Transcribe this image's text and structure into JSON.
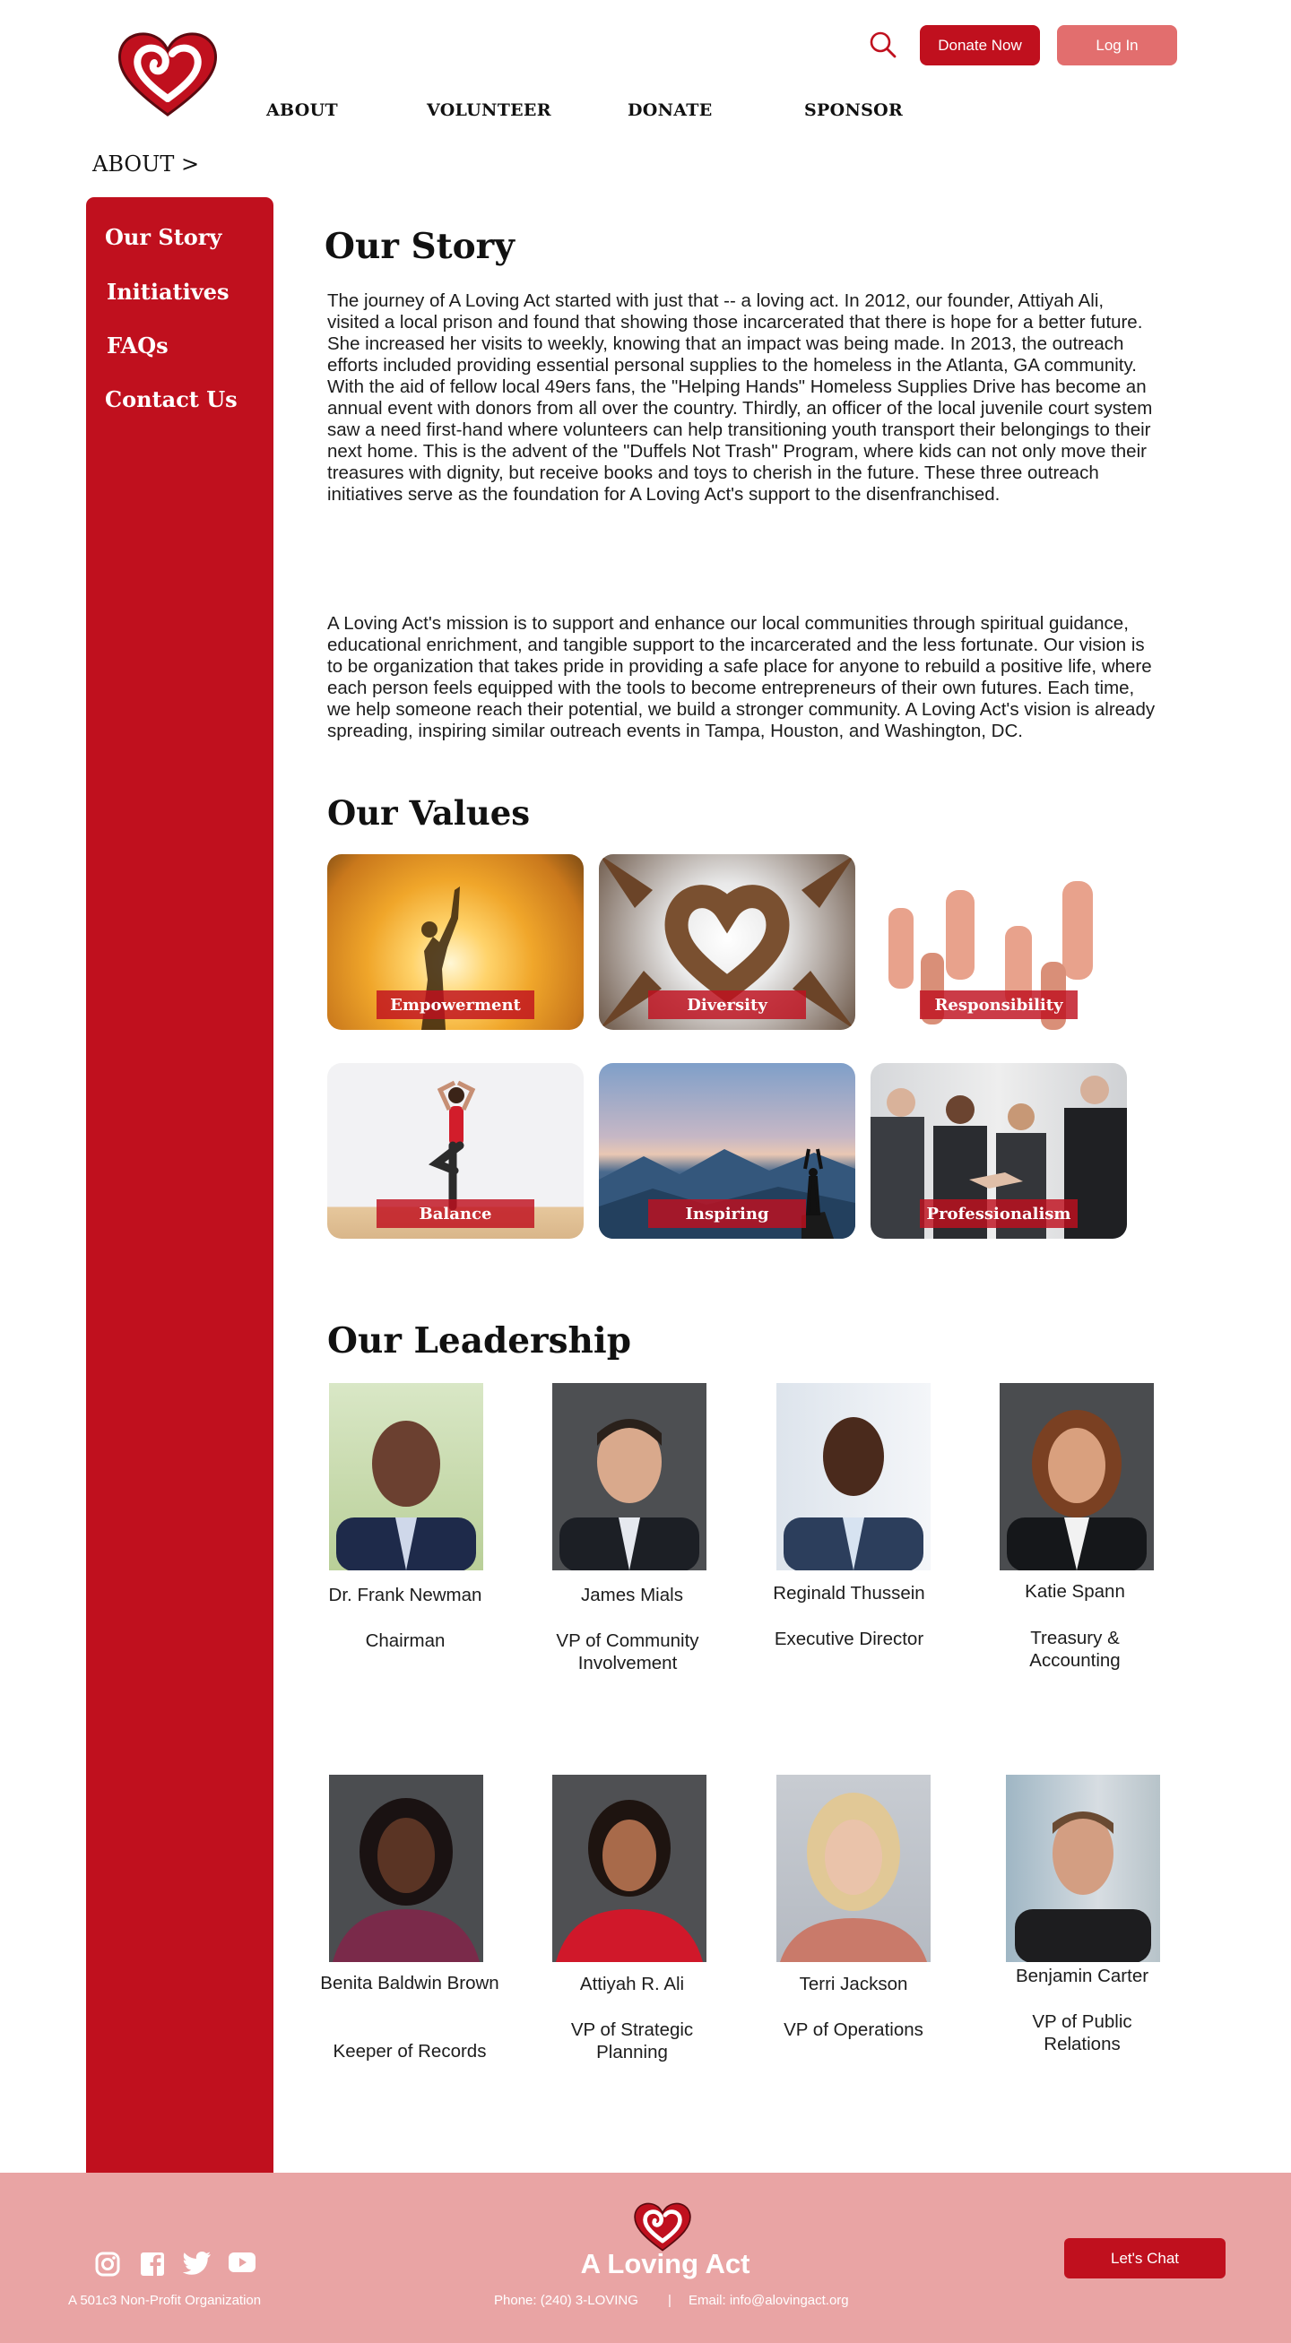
{
  "brand": {
    "name": "A Loving Act",
    "accent": "#c0101e",
    "accent_light": "#e26e6e",
    "footer_bg": "#e9a4a4"
  },
  "header": {
    "search_icon": "search-icon",
    "donate_label": "Donate Now",
    "login_label": "Log In",
    "nav": [
      "ABOUT",
      "VOLUNTEER",
      "DONATE",
      "SPONSOR"
    ]
  },
  "breadcrumb": "ABOUT >",
  "sidebar": {
    "items": [
      "Our Story",
      "Initiatives",
      "FAQs",
      "Contact Us"
    ]
  },
  "story": {
    "title": "Our Story",
    "para1": "The journey of A Loving Act started with just that -- a loving act.  In 2012, our founder, Attiyah Ali, visited a local prison and found that showing those incarcerated that there is hope for a better future.  She increased her visits to weekly, knowing that an impact was being made.  In 2013, the outreach efforts included providing essential personal supplies to the homeless in the Atlanta, GA community.  With the aid of fellow local 49ers fans, the \"Helping Hands\" Homeless Supplies Drive has become an annual event with donors from all over the country. Thirdly, an officer of the local juvenile court system saw a need first-hand where volunteers can help transitioning youth transport their belongings to their next home. This is the advent of the \"Duffels Not Trash\" Program, where kids can not only move their treasures with dignity, but receive books and toys to cherish in the future.  These three outreach initiatives serve as the foundation for A Loving Act's support to the disenfranchised.",
    "para2": "A Loving Act's mission is to support and enhance our local communities through spiritual guidance, educational enrichment, and tangible support to the incarcerated and the less fortunate.  Our vision is to be organization that takes pride in providing a safe place for anyone to rebuild a positive life, where each person feels equipped with the tools to become entrepreneurs of their own futures. Each time, we help someone reach their potential, we build a stronger community.  A Loving Act's vision is already spreading, inspiring similar outreach events in Tampa, Houston, and Washington, DC."
  },
  "values": {
    "title": "Our Values",
    "items": [
      "Empowerment",
      "Diversity",
      "Responsibility",
      "Balance",
      "Inspiring",
      "Professionalism"
    ]
  },
  "leadership": {
    "title": "Our Leadership",
    "people": [
      {
        "name": "Dr. Frank Newman",
        "role": "Chairman"
      },
      {
        "name": "James Mials",
        "role": "VP of Community Involvement"
      },
      {
        "name": "Reginald Thussein",
        "role": "Executive Director"
      },
      {
        "name": "Katie Spann",
        "role": "Treasury & Accounting"
      },
      {
        "name": "Benita Baldwin Brown",
        "role": "Keeper of Records"
      },
      {
        "name": "Attiyah R. Ali",
        "role": "VP of Strategic Planning"
      },
      {
        "name": "Terri Jackson",
        "role": "VP of Operations"
      },
      {
        "name": "Benjamin Carter",
        "role": "VP of Public Relations"
      }
    ]
  },
  "footer": {
    "socials": [
      "instagram-icon",
      "facebook-icon",
      "twitter-icon",
      "youtube-icon"
    ],
    "tagline": "A 501c3 Non-Profit Organization",
    "brand_name": "A Loving Act",
    "phone": "Phone:  (240) 3-LOVING",
    "separator": "|",
    "email": "Email:  info@alovingact.org",
    "chat_label": "Let's Chat"
  }
}
